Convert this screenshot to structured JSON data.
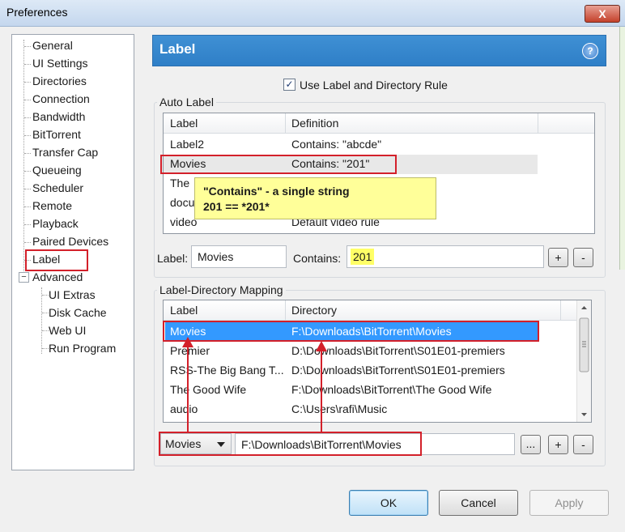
{
  "window": {
    "title": "Preferences",
    "close_label": "X"
  },
  "tree": {
    "items": [
      "General",
      "UI Settings",
      "Directories",
      "Connection",
      "Bandwidth",
      "BitTorrent",
      "Transfer Cap",
      "Queueing",
      "Scheduler",
      "Remote",
      "Playback",
      "Paired Devices",
      "Label",
      "Advanced"
    ],
    "advanced_children": [
      "UI Extras",
      "Disk Cache",
      "Web UI",
      "Run Program"
    ],
    "selected": "Label",
    "expander": "−"
  },
  "header": {
    "title": "Label",
    "help_label": "?"
  },
  "use_rule": {
    "label": "Use Label and Directory Rule",
    "checked": true,
    "check_glyph": "✓"
  },
  "auto_label": {
    "group_title": "Auto Label",
    "columns": [
      "Label",
      "Definition"
    ],
    "rows": [
      {
        "label": "Label2",
        "definition": "Contains: \"abcde\""
      },
      {
        "label": "Movies",
        "definition": "Contains: \"201\""
      },
      {
        "label": "The",
        "definition": ""
      },
      {
        "label": "docu",
        "definition": ""
      },
      {
        "label": "video",
        "definition": "Default video rule"
      }
    ],
    "tooltip_line1": "\"Contains\" - a single string",
    "tooltip_line2": "201 == *201*",
    "label_field_caption": "Label:",
    "label_field_value": "Movies",
    "contains_caption": "Contains:",
    "contains_value": "201",
    "add_label": "+",
    "remove_label": "-"
  },
  "mapping": {
    "group_title": "Label-Directory Mapping",
    "columns": [
      "Label",
      "Directory"
    ],
    "rows": [
      {
        "label": "Movies",
        "directory": "F:\\Downloads\\BitTorrent\\Movies"
      },
      {
        "label": "Premier",
        "directory": "D:\\Downloads\\BitTorrent\\S01E01-premiers"
      },
      {
        "label": "RSS-The Big Bang T...",
        "directory": "D:\\Downloads\\BitTorrent\\S01E01-premiers"
      },
      {
        "label": "The Good Wife",
        "directory": "F:\\Downloads\\BitTorrent\\The Good Wife"
      },
      {
        "label": "audio",
        "directory": "C:\\Users\\rafi\\Music"
      }
    ],
    "selected_label": "Movies",
    "path_value": "F:\\Downloads\\BitTorrent\\Movies",
    "browse_label": "...",
    "add_label": "+",
    "remove_label": "-"
  },
  "footer": {
    "ok_label": "OK",
    "cancel_label": "Cancel",
    "apply_label": "Apply"
  },
  "colors": {
    "accent": "#3f90d4",
    "highlight": "#3399ff",
    "annotation": "#d3202a",
    "tooltip": "#ffff99"
  }
}
